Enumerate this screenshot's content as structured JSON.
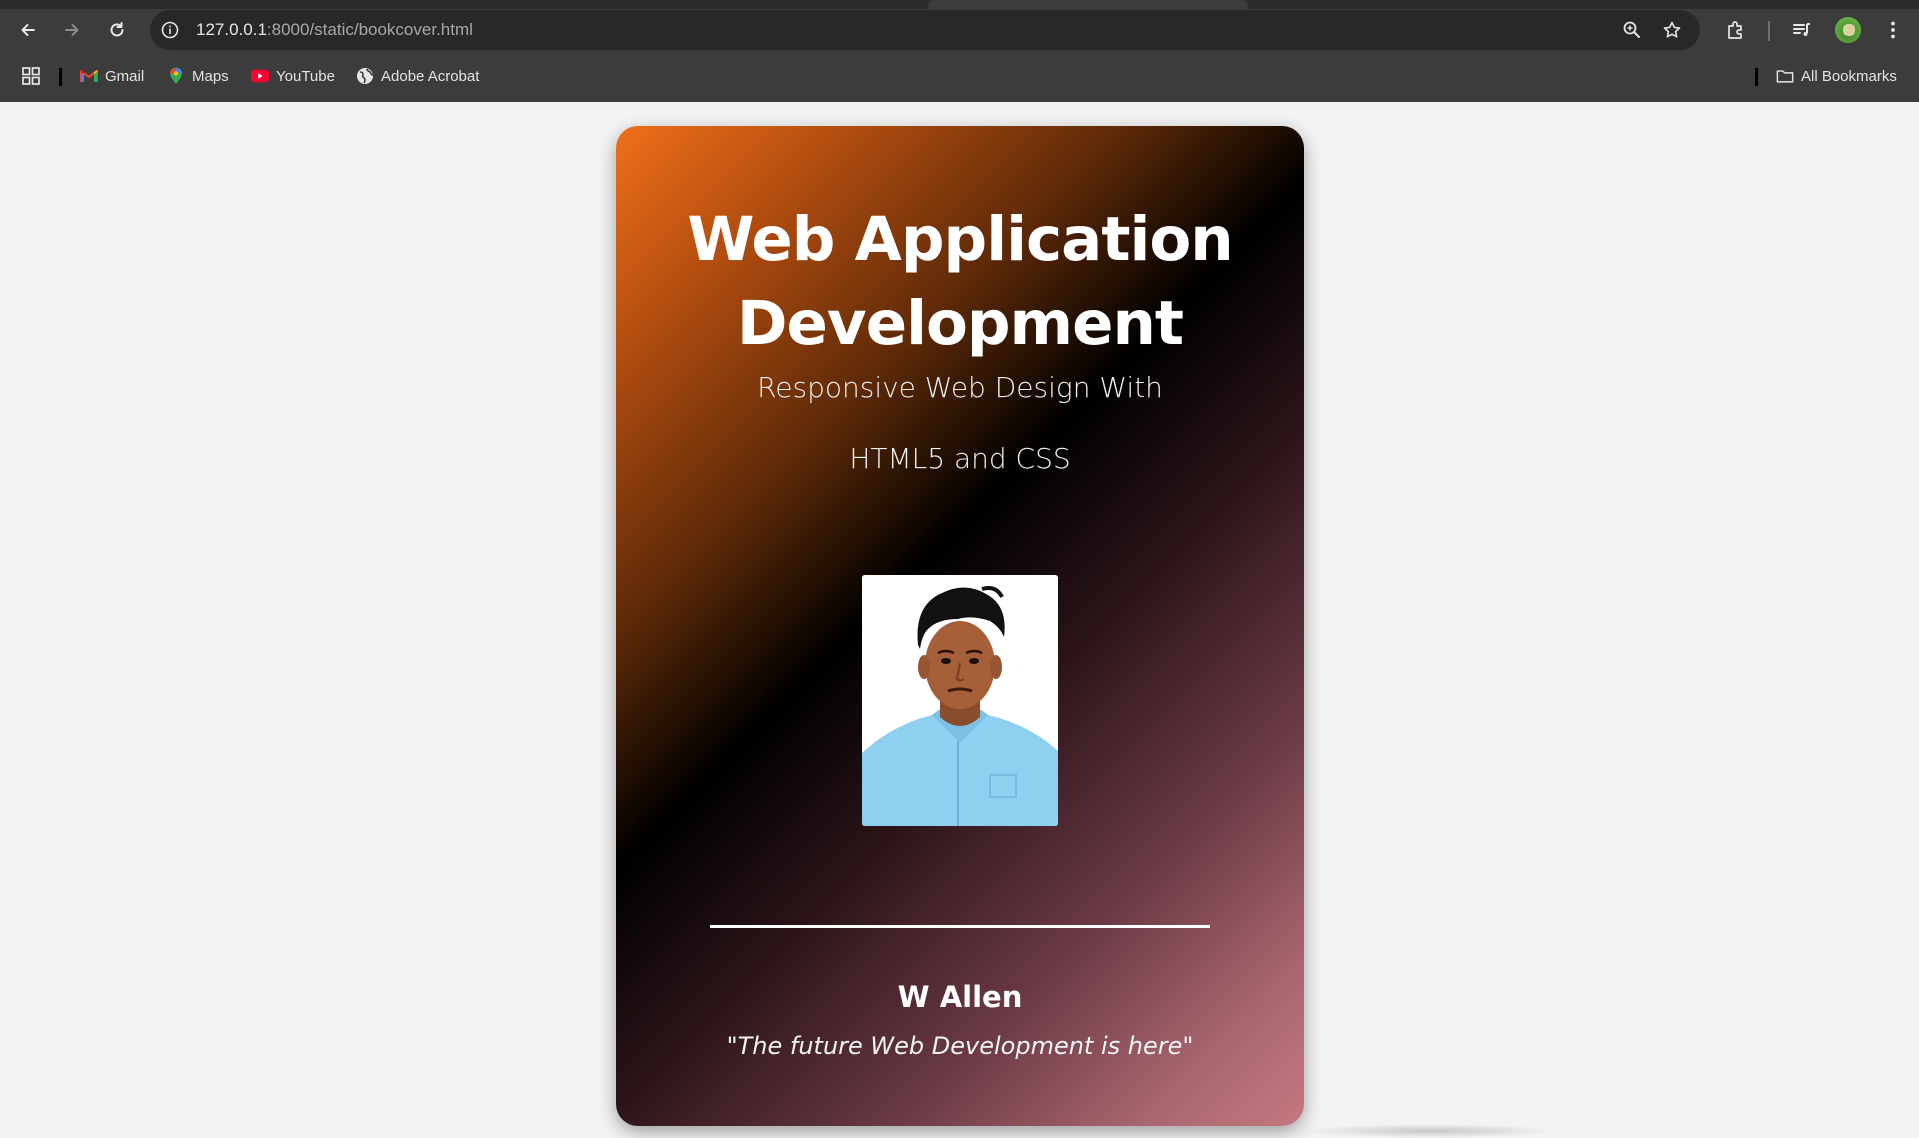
{
  "browser": {
    "url_host": "127.0.0.1",
    "url_path": ":8000/static/bookcover.html",
    "bookmarks": [
      {
        "label": "Gmail",
        "icon": "gmail-icon"
      },
      {
        "label": "Maps",
        "icon": "maps-icon"
      },
      {
        "label": "YouTube",
        "icon": "youtube-icon"
      },
      {
        "label": "Adobe Acrobat",
        "icon": "globe-icon"
      }
    ],
    "all_bookmarks_label": "All Bookmarks"
  },
  "cover": {
    "title_line1": "Web Application",
    "title_line2": "Development",
    "subtitle_line1": "Responsive Web Design With",
    "subtitle_line2": "HTML5 and CSS",
    "author": "W Allen",
    "quote": "\"The future Web Development is here\"",
    "colors": {
      "gradient_start": "#ef6f1a",
      "gradient_mid": "#000000",
      "gradient_end": "#c57880"
    }
  }
}
